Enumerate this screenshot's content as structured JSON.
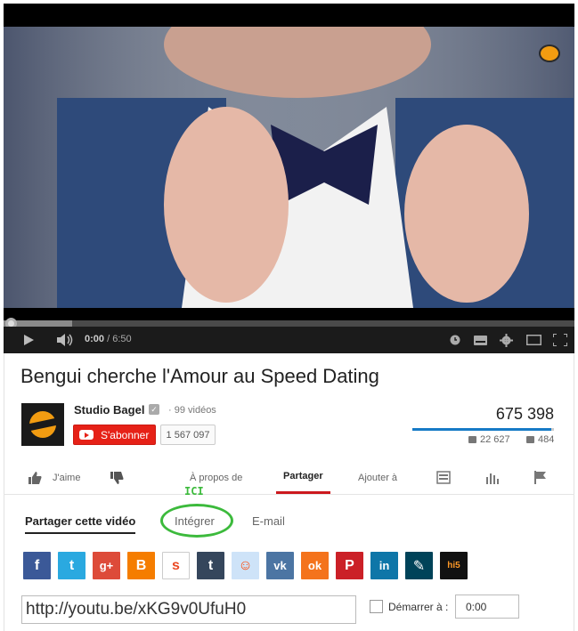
{
  "player": {
    "time_current": "0:00",
    "time_duration": "6:50",
    "time_separator": " / ",
    "progress_loaded_fraction": 0.12,
    "icons": [
      "play-icon",
      "volume-icon",
      "clock-icon",
      "subtitles-icon",
      "settings-icon",
      "miniplayer-icon",
      "fullscreen-icon"
    ]
  },
  "video": {
    "title": "Bengui cherche l'Amour au Speed Dating",
    "views": "675 398",
    "likes": "22 627",
    "dislikes": "484",
    "like_ratio": 0.979
  },
  "channel": {
    "name": "Studio Bagel",
    "verified_icon": "check-icon",
    "video_count": "· 99 vidéos",
    "subscribe_label": "S'abonner",
    "subscriber_count": "1 567 097",
    "brand_color": "#e62117"
  },
  "actions": {
    "like_label": "J'aime",
    "about_label": "À propos de",
    "share_label": "Partager",
    "add_to_label": "Ajouter à"
  },
  "annotation": {
    "text": "ICI",
    "color": "#3cba3c"
  },
  "share": {
    "tabs": [
      "Partager cette vidéo",
      "Intégrer",
      "E-mail"
    ],
    "url": "http://youtu.be/xKG9v0UfuH0",
    "start_label": "Démarrer à :",
    "start_time": "0:00",
    "networks": [
      {
        "name": "facebook",
        "glyph": "f",
        "color": "#3b5998"
      },
      {
        "name": "twitter",
        "glyph": "t",
        "color": "#2aa9e0"
      },
      {
        "name": "google-plus",
        "glyph": "g+",
        "color": "#dd4b39"
      },
      {
        "name": "blogger",
        "glyph": "B",
        "color": "#f57d00"
      },
      {
        "name": "stumbleupon",
        "glyph": "s",
        "color": "#ffffff"
      },
      {
        "name": "tumblr",
        "glyph": "t",
        "color": "#35465c"
      },
      {
        "name": "reddit",
        "glyph": "☺",
        "color": "#cee3f8"
      },
      {
        "name": "vk",
        "glyph": "vk",
        "color": "#4c75a3"
      },
      {
        "name": "odnoklassniki",
        "glyph": "ok",
        "color": "#f4731c"
      },
      {
        "name": "pinterest",
        "glyph": "P",
        "color": "#cb2027"
      },
      {
        "name": "linkedin",
        "glyph": "in",
        "color": "#0e76a8"
      },
      {
        "name": "livejournal",
        "glyph": "✎",
        "color": "#004359"
      },
      {
        "name": "hi5",
        "glyph": "hi5",
        "color": "#fd9827"
      }
    ]
  }
}
